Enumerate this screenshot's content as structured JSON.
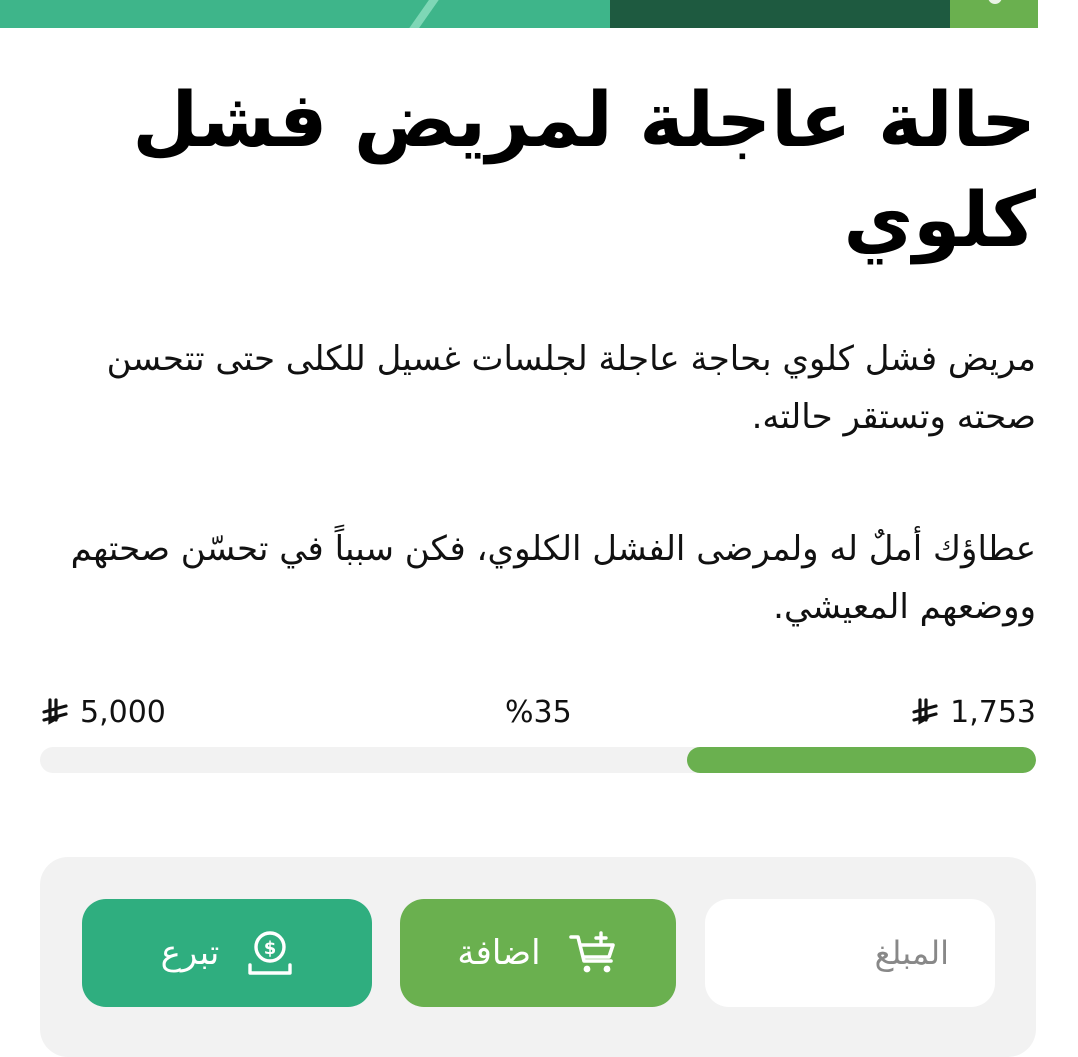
{
  "campaign": {
    "title": "حالة عاجلة لمريض فشل كلوي",
    "description_1": "مريض فشل كلوي بحاجة عاجلة لجلسات غسيل للكلى حتى تتحسن صحته وتستقر حالته.",
    "description_2": "عطاؤك أملٌ له ولمرضى الفشل الكلوي، فكن سبباً في تحسّن صحتهم ووضعهم المعيشي."
  },
  "progress": {
    "raised": "1,753",
    "goal": "5,000",
    "percent_label": "%35",
    "percent_value": 35,
    "currency_icon": "saudi-riyal-icon"
  },
  "actions": {
    "amount_placeholder": "المبلغ",
    "add_label": "اضافة",
    "add_icon": "cart-plus-icon",
    "donate_label": "تبرع",
    "donate_icon": "money-hand-icon"
  },
  "colors": {
    "primary_green": "#2fae7f",
    "secondary_green": "#6ab04f",
    "dark_green": "#1e5a40",
    "panel_bg": "#f2f2f2"
  }
}
